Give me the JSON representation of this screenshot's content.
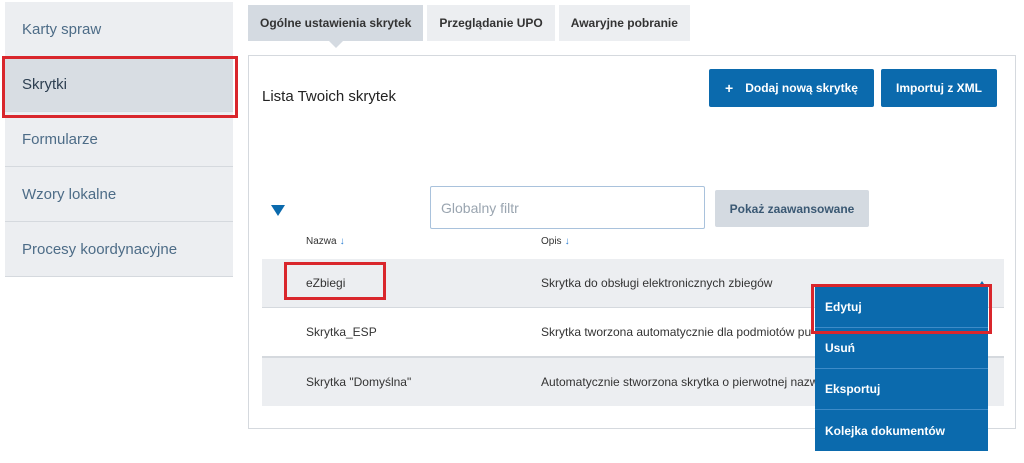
{
  "sidebar": {
    "items": [
      {
        "label": "Karty spraw"
      },
      {
        "label": "Skrytki"
      },
      {
        "label": "Formularze"
      },
      {
        "label": "Wzory lokalne"
      },
      {
        "label": "Procesy koordynacyjne"
      }
    ],
    "active": "Skrytki"
  },
  "tabs": [
    {
      "label": "Ogólne ustawienia skrytek"
    },
    {
      "label": "Przeglądanie UPO"
    },
    {
      "label": "Awaryjne pobranie"
    }
  ],
  "panel": {
    "title": "Lista Twoich skrytek",
    "add_button": "Dodaj nową skrytkę",
    "import_button": "Importuj z XML",
    "filter_placeholder": "Globalny filtr",
    "advanced_button": "Pokaż zaawansowane"
  },
  "table": {
    "columns": [
      {
        "label": "Nazwa"
      },
      {
        "label": "Opis"
      }
    ],
    "sort_indicator": "↓",
    "rows": [
      {
        "name": "eZbiegi",
        "description": "Skrytka do obsługi elektronicznych zbiegów"
      },
      {
        "name": "Skrytka_ESP",
        "description": "Skrytka tworzona automatycznie dla podmiotów pu"
      },
      {
        "name": "Skrytka \"Domyślna\"",
        "description": "Automatycznie stworzona skrytka o pierwotnej nazw"
      }
    ]
  },
  "context_menu": {
    "items": [
      {
        "label": "Edytuj"
      },
      {
        "label": "Usuń"
      },
      {
        "label": "Eksportuj"
      },
      {
        "label": "Kolejka dokumentów"
      }
    ]
  },
  "colors": {
    "primary": "#0b6aad",
    "highlight": "#d9262c",
    "sidebar_bg": "#eceef1"
  },
  "icons": {
    "add": "plus-icon",
    "collapse": "triangle-down-icon",
    "sort": "arrow-down-icon",
    "row_action": "caret-up-icon"
  }
}
